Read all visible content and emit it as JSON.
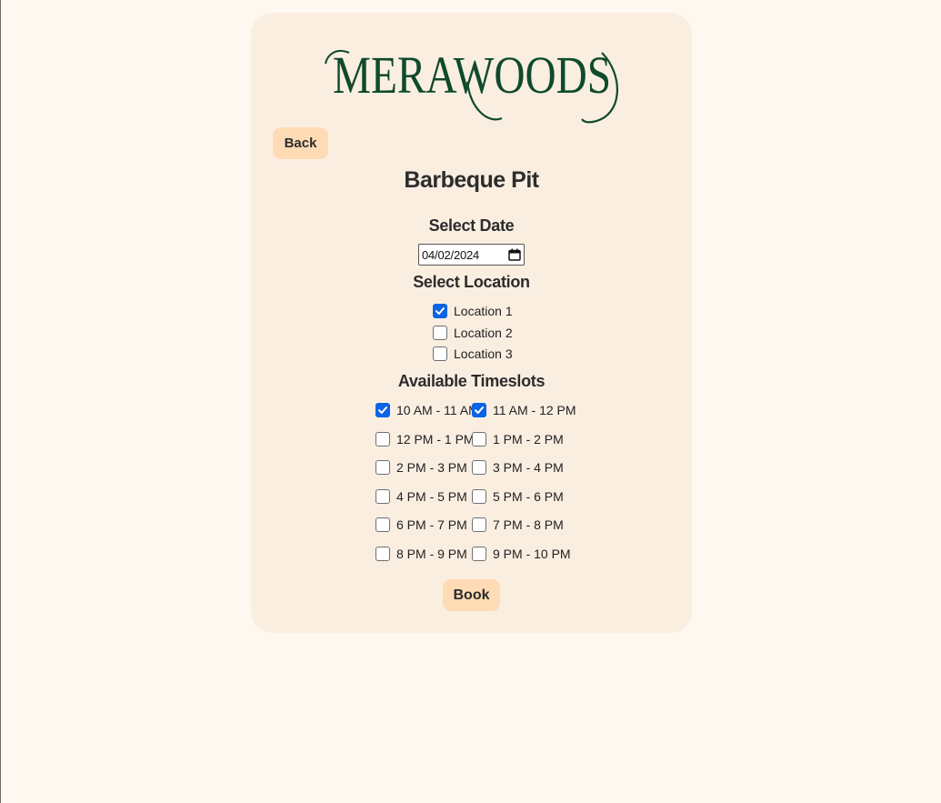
{
  "brand": {
    "logo_text": "MERAWOODS",
    "logo_color": "#0f4a2c"
  },
  "nav": {
    "back_label": "Back"
  },
  "page": {
    "title": "Barbeque Pit"
  },
  "date_section": {
    "heading": "Select Date",
    "value": "04/02/2024"
  },
  "location_section": {
    "heading": "Select Location",
    "options": [
      {
        "label": "Location 1",
        "checked": true
      },
      {
        "label": "Location 2",
        "checked": false
      },
      {
        "label": "Location 3",
        "checked": false
      }
    ]
  },
  "timeslot_section": {
    "heading": "Available Timeslots",
    "slots": [
      {
        "label": "10 AM - 11 AM",
        "checked": true
      },
      {
        "label": "11 AM - 12 PM",
        "checked": true
      },
      {
        "label": "12 PM - 1 PM",
        "checked": false
      },
      {
        "label": "1 PM - 2 PM",
        "checked": false
      },
      {
        "label": "2 PM - 3 PM",
        "checked": false
      },
      {
        "label": "3 PM - 4 PM",
        "checked": false
      },
      {
        "label": "4 PM - 5 PM",
        "checked": false
      },
      {
        "label": "5 PM - 6 PM",
        "checked": false
      },
      {
        "label": "6 PM - 7 PM",
        "checked": false
      },
      {
        "label": "7 PM - 8 PM",
        "checked": false
      },
      {
        "label": "8 PM - 9 PM",
        "checked": false
      },
      {
        "label": "9 PM - 10 PM",
        "checked": false
      }
    ]
  },
  "actions": {
    "book_label": "Book"
  },
  "colors": {
    "page_bg": "#fef8f1",
    "card_bg": "#faeee1",
    "button_bg": "#ffdbb5",
    "checkbox_accent": "#0b63e5"
  }
}
